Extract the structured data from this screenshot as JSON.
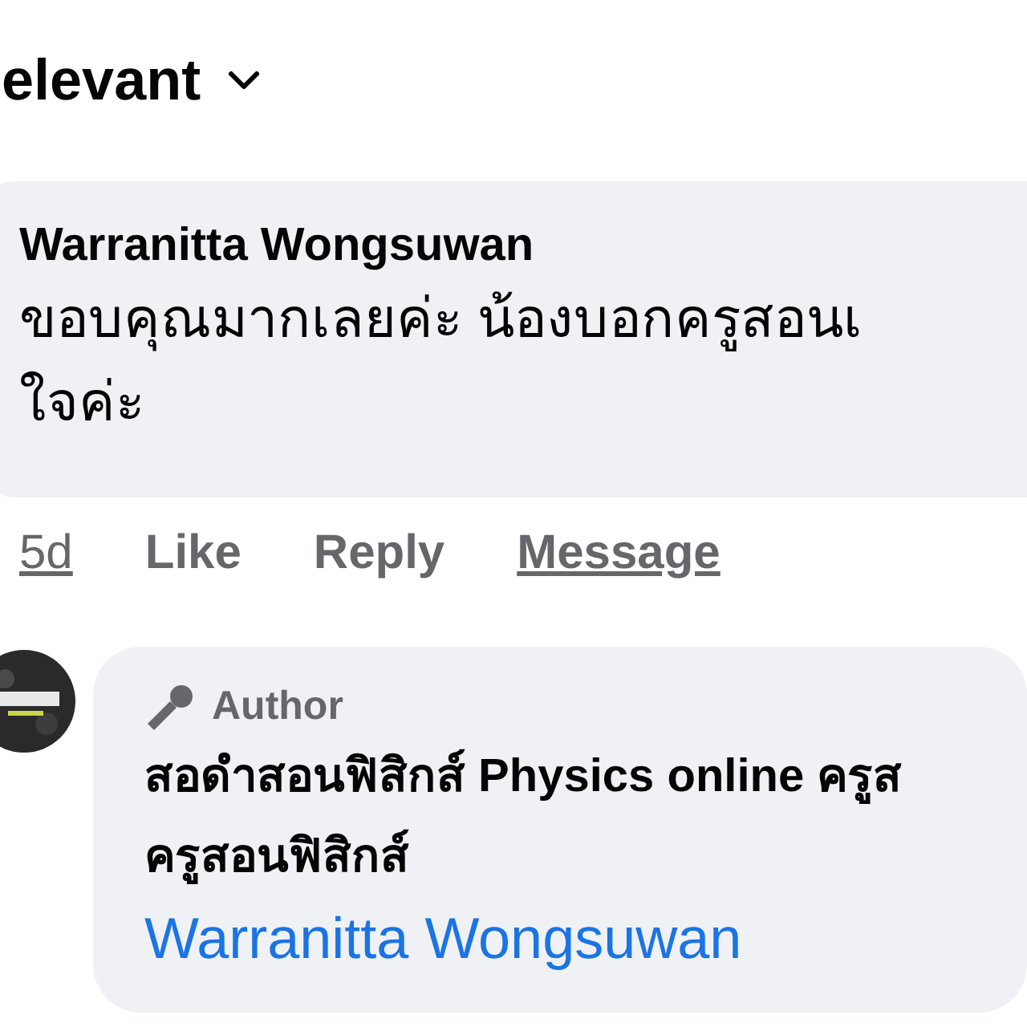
{
  "sort": {
    "label": "elevant"
  },
  "comment": {
    "author": "Warranitta Wongsuwan",
    "lines": [
      "ขอบคุณมากเลยค่ะ น้องบอกครูสอนเ",
      "ใจค่ะ"
    ],
    "actions": [
      {
        "label": "5d",
        "kind": "time"
      },
      {
        "label": "Like",
        "kind": "action"
      },
      {
        "label": "Reply",
        "kind": "action"
      },
      {
        "label": "Message",
        "kind": "link"
      }
    ]
  },
  "reply": {
    "badge": "Author",
    "author_lines": [
      "สอดำสอนฟิสิกส์ Physics online ครูส",
      "ครูสอนฟิสิกส์"
    ],
    "mention": "Warranitta Wongsuwan"
  }
}
